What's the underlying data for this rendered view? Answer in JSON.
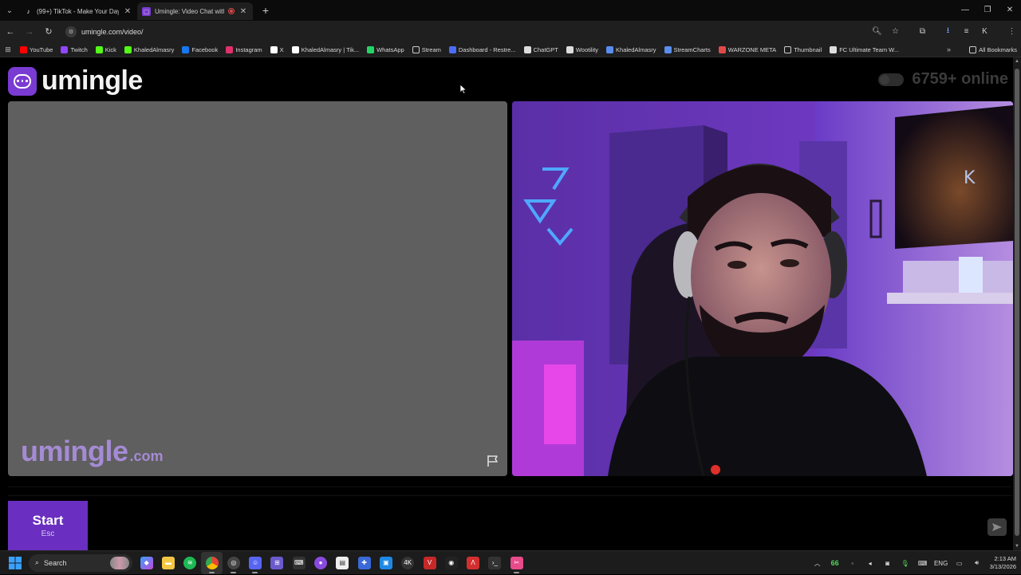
{
  "browser": {
    "tabs": [
      {
        "title": "(99+) TikTok - Make Your Day",
        "active": false,
        "favicon": "tiktok-icon"
      },
      {
        "title": "Umingle: Video Chat with S",
        "active": true,
        "favicon": "umingle-icon",
        "recording": true
      }
    ],
    "url": "umingle.com/video/",
    "bookmarks": [
      {
        "label": "YouTube",
        "icon": "youtube-icon",
        "color": "#ff0000"
      },
      {
        "label": "Twitch",
        "icon": "twitch-icon",
        "color": "#9146ff"
      },
      {
        "label": "Kick",
        "icon": "kick-icon",
        "color": "#53fc18"
      },
      {
        "label": "KhaledAlmasry",
        "icon": "kick-icon",
        "color": "#53fc18"
      },
      {
        "label": "Facebook",
        "icon": "facebook-icon",
        "color": "#1877f2"
      },
      {
        "label": "Instagram",
        "icon": "instagram-icon",
        "color": "#e1306c"
      },
      {
        "label": "X",
        "icon": "x-icon",
        "color": "#ffffff"
      },
      {
        "label": "KhaledAlmasry | Tik...",
        "icon": "tiktok-icon",
        "color": "#ffffff"
      },
      {
        "label": "WhatsApp",
        "icon": "whatsapp-icon",
        "color": "#25d366"
      },
      {
        "label": "Stream",
        "icon": "folder-icon",
        "color": "#cccccc"
      },
      {
        "label": "Dashboard - Restre...",
        "icon": "restream-icon",
        "color": "#4a6cf7"
      },
      {
        "label": "ChatGPT",
        "icon": "chatgpt-icon",
        "color": "#dddddd"
      },
      {
        "label": "Wootility",
        "icon": "wootility-icon",
        "color": "#dddddd"
      },
      {
        "label": "KhaledAlmasry",
        "icon": "meta-icon",
        "color": "#5a8dee"
      },
      {
        "label": "StreamCharts",
        "icon": "streamcharts-icon",
        "color": "#5a8dee"
      },
      {
        "label": "WARZONE META",
        "icon": "warzone-icon",
        "color": "#e04a4a"
      },
      {
        "label": "Thumbnail",
        "icon": "folder-icon",
        "color": "#cccccc"
      },
      {
        "label": "FC Ultimate Team W...",
        "icon": "fc-icon",
        "color": "#dddddd"
      }
    ],
    "all_bookmarks": "All Bookmarks"
  },
  "page": {
    "brand": "umingle",
    "online_text": "6759+ online",
    "watermark_main": "umingle",
    "watermark_domain": ".com",
    "start_label": "Start",
    "start_key": "Esc"
  },
  "taskbar": {
    "search_label": "Search",
    "tray_count": "66",
    "language": "ENG",
    "time": "2:13 AM",
    "date": "3/13/2026"
  },
  "colors": {
    "accent": "#6a2fc0",
    "brand_purple": "#7a3bd2",
    "watermark": "#a58bd4",
    "left_video_bg": "#5f5f5f"
  }
}
